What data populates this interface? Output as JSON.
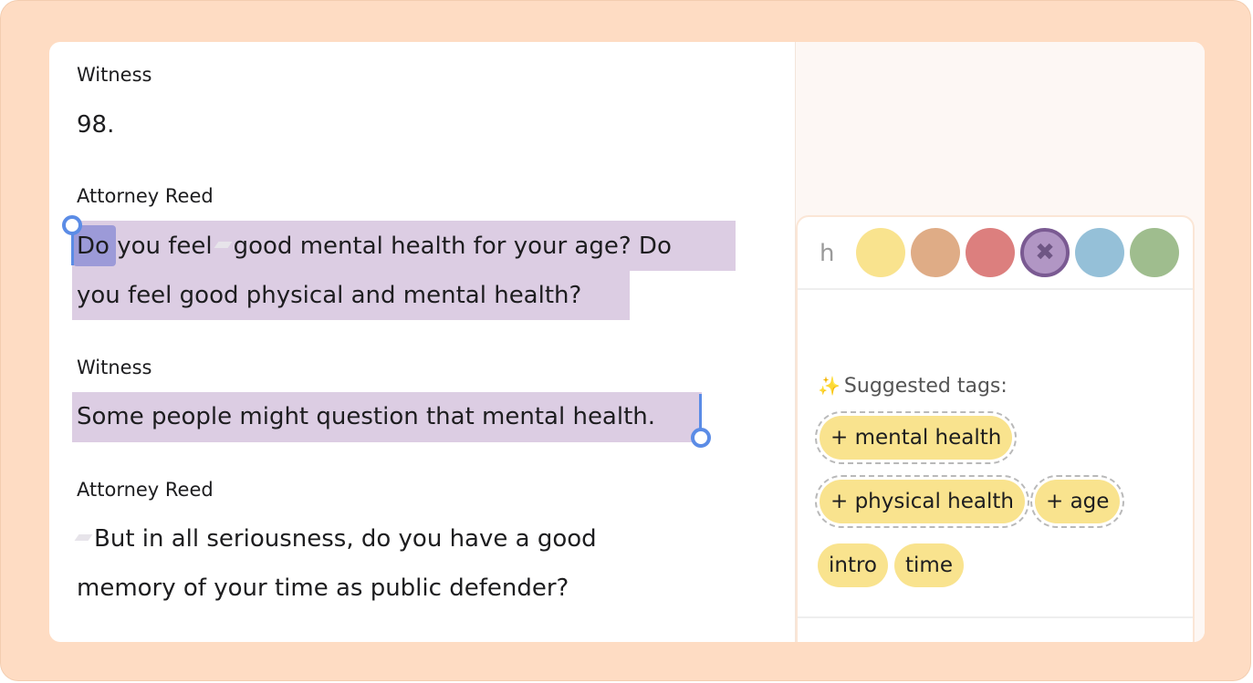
{
  "transcript": {
    "entries": [
      {
        "speaker": "Witness",
        "lines": [
          "98."
        ]
      },
      {
        "speaker": "Attorney Reed",
        "lines": [
          "Do you feel",
          "good mental health for your age? Do",
          "you feel good physical and mental health?"
        ]
      },
      {
        "speaker": "Witness",
        "lines": [
          "Some people might question that mental health."
        ]
      },
      {
        "speaker": "Attorney Reed",
        "lines": [
          "But in all seriousness, do you have a good",
          "memory of your time as public defender?"
        ]
      }
    ]
  },
  "tag_panel": {
    "search_value": "h",
    "colors": [
      {
        "name": "yellow",
        "hex": "#f9e38e"
      },
      {
        "name": "tan",
        "hex": "#dfac86"
      },
      {
        "name": "red",
        "hex": "#dc7f7e"
      },
      {
        "name": "purple",
        "hex": "#b196c4"
      },
      {
        "name": "blue",
        "hex": "#95c0d8"
      },
      {
        "name": "green",
        "hex": "#9fbd8e"
      }
    ],
    "selected_color_symbol": "✖",
    "suggested_label": "Suggested tags:",
    "suggested_tags": [
      "+ mental health",
      "+ physical health",
      "+ age"
    ],
    "applied_tags": [
      "intro",
      "time"
    ]
  },
  "colors": {
    "frame": "#fedcc3",
    "highlight": "#dccde3",
    "selection": "#9c9ad8",
    "caret": "#5b8ce6",
    "tag_chip": "#f9e38e"
  },
  "icons": {
    "sparkle": "✨",
    "remove": "✖"
  }
}
